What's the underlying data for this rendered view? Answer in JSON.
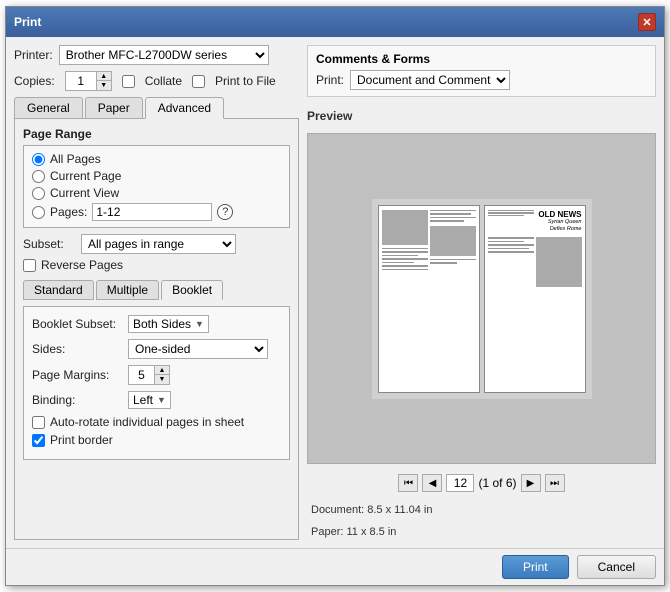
{
  "dialog": {
    "title": "Print",
    "close_label": "✕"
  },
  "printer": {
    "label": "Printer:",
    "value": "Brother MFC-L2700DW series"
  },
  "copies": {
    "label": "Copies:",
    "value": "1"
  },
  "collate": {
    "label": "Collate",
    "checked": false
  },
  "print_to_file": {
    "label": "Print to File",
    "checked": false
  },
  "tabs": {
    "general": "General",
    "paper": "Paper",
    "advanced": "Advanced",
    "active": "Advanced"
  },
  "page_range": {
    "title": "Page Range",
    "all_pages": "All Pages",
    "current_page": "Current Page",
    "current_view": "Current View",
    "pages_label": "Pages:",
    "pages_value": "1-12",
    "help": "?",
    "subset_label": "Subset:",
    "subset_value": "All pages in range",
    "reverse_label": "Reverse Pages",
    "selected": "all_pages"
  },
  "subtabs": {
    "standard": "Standard",
    "multiple": "Multiple",
    "booklet": "Booklet",
    "active": "Booklet"
  },
  "booklet": {
    "subset_label": "Booklet Subset:",
    "subset_value": "Both Sides",
    "sides_label": "Sides:",
    "sides_value": "One-sided",
    "margins_label": "Page Margins:",
    "margins_value": "5",
    "binding_label": "Binding:",
    "binding_value": "Left",
    "auto_rotate_label": "Auto-rotate individual pages in sheet",
    "auto_rotate_checked": false,
    "print_border_label": "Print border",
    "print_border_checked": true
  },
  "comments_forms": {
    "title": "Comments & Forms",
    "print_label": "Print:",
    "print_value": "Document and Comments"
  },
  "preview": {
    "title": "Preview",
    "page_num": "12",
    "page_of": "(1 of 6)",
    "headline": "OLD NEWS",
    "subheadline1": "Syrian Queen",
    "subheadline2": "Defies Rome",
    "document_info": "Document: 8.5 x 11.04 in",
    "paper_info": "Paper:       11 x 8.5 in"
  },
  "footer": {
    "print_label": "Print",
    "cancel_label": "Cancel"
  }
}
